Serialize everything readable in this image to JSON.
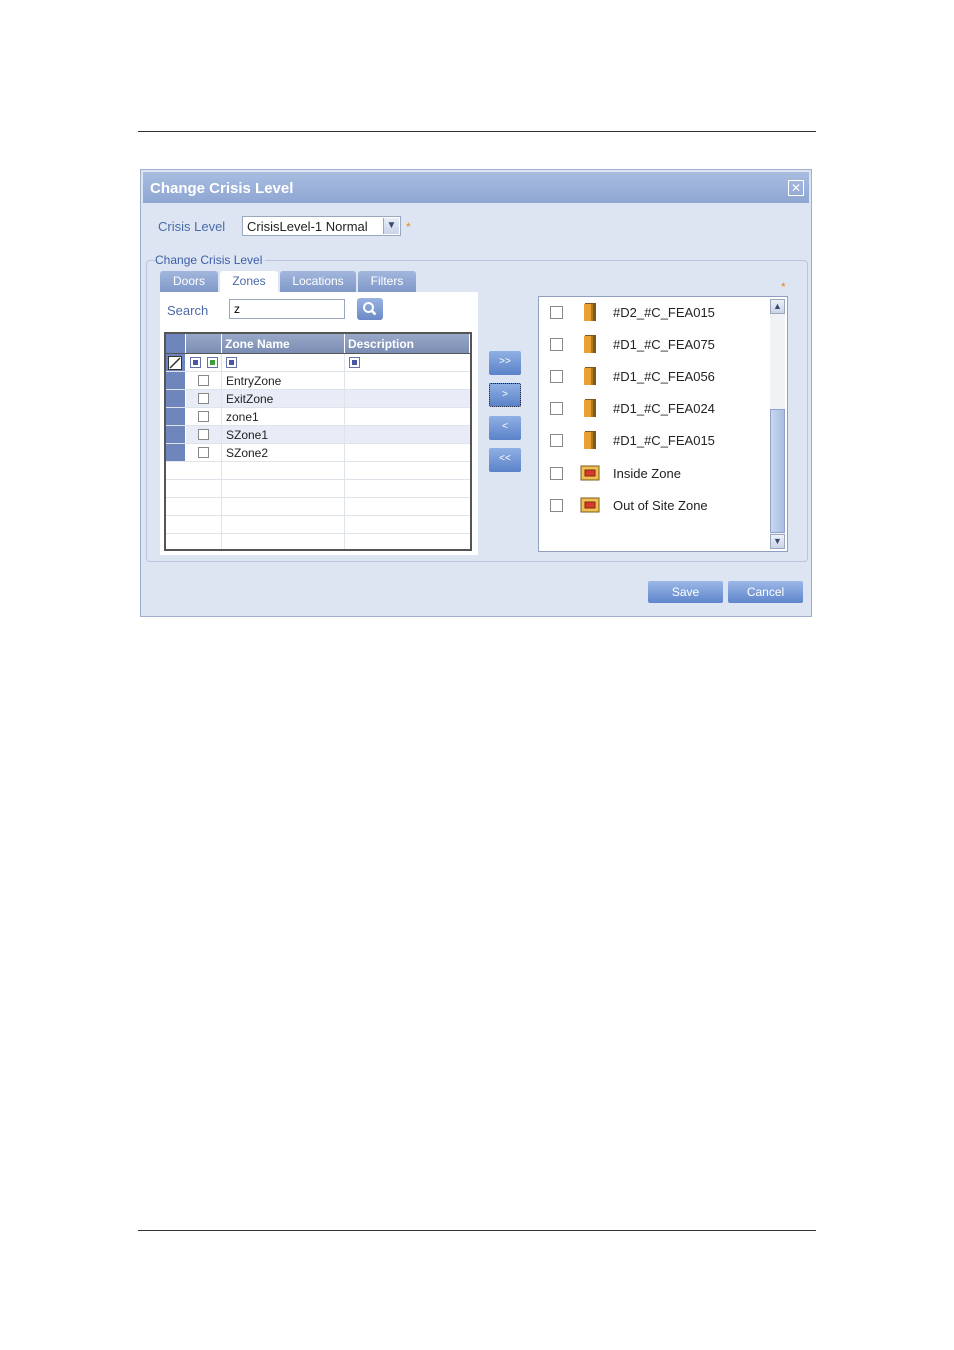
{
  "dialog": {
    "title": "Change Crisis Level",
    "crisis_level_label": "Crisis Level",
    "crisis_level_value": "CrisisLevel-1  Normal",
    "required_mark": "*",
    "group_legend": "Change Crisis Level"
  },
  "tabs": [
    {
      "label": "Doors"
    },
    {
      "label": "Zones"
    },
    {
      "label": "Locations"
    },
    {
      "label": "Filters"
    }
  ],
  "active_tab": "Zones",
  "search": {
    "label": "Search",
    "value": "z"
  },
  "grid": {
    "columns": [
      "Zone Name",
      "Description"
    ],
    "rows": [
      {
        "name": "EntryZone",
        "description": ""
      },
      {
        "name": "ExitZone",
        "description": ""
      },
      {
        "name": "zone1",
        "description": ""
      },
      {
        "name": "SZone1",
        "description": ""
      },
      {
        "name": "SZone2",
        "description": ""
      }
    ]
  },
  "move_buttons": {
    "add_all": ">>",
    "add_one": ">",
    "remove_one": "<",
    "remove_all": "<<"
  },
  "selected_items": [
    {
      "label": "#D2_#C_FEA015",
      "icon": "door-icon"
    },
    {
      "label": "#D1_#C_FEA075",
      "icon": "door-icon"
    },
    {
      "label": "#D1_#C_FEA056",
      "icon": "door-icon"
    },
    {
      "label": "#D1_#C_FEA024",
      "icon": "door-icon"
    },
    {
      "label": "#D1_#C_FEA015",
      "icon": "door-icon"
    },
    {
      "label": "Inside Zone",
      "icon": "zone-icon"
    },
    {
      "label": "Out of Site Zone",
      "icon": "zone-icon"
    }
  ],
  "footer": {
    "save_label": "Save",
    "cancel_label": "Cancel"
  },
  "colors": {
    "title_bar": "#8ea6d2",
    "dialog_bg": "#dde5f2",
    "accent_text": "#4a6aa8",
    "required": "#e88a1a"
  }
}
